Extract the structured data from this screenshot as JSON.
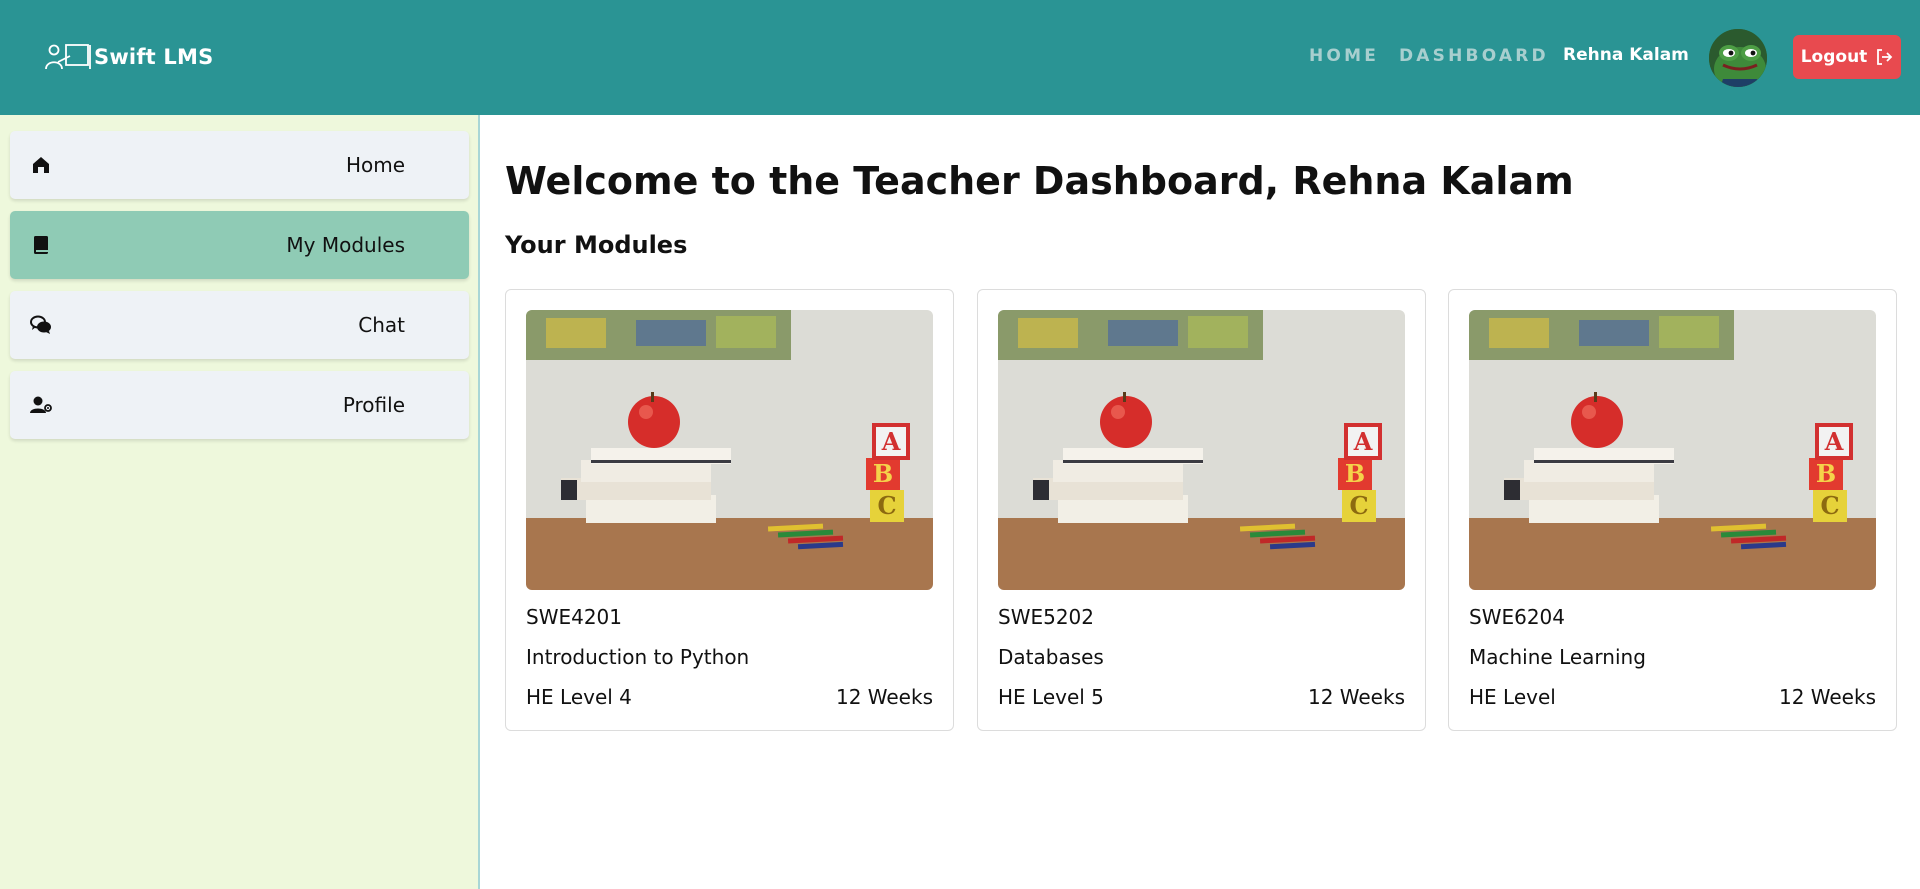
{
  "navbar": {
    "brand": "Swift LMS",
    "links": {
      "home": "HOME",
      "dashboard": "DASHBOARD"
    },
    "user_name": "Rehna Kalam",
    "logout_label": "Logout",
    "bg_color": "#2a9494",
    "logout_color": "#e84a4f"
  },
  "sidebar": {
    "items": [
      {
        "label": "Home",
        "icon": "home-icon"
      },
      {
        "label": "My Modules",
        "icon": "book-icon",
        "active": true
      },
      {
        "label": "Chat",
        "icon": "chat-icon"
      },
      {
        "label": "Profile",
        "icon": "user-gear-icon"
      }
    ],
    "active_color": "#8fcbb5",
    "bg_color": "#eef8dc"
  },
  "main": {
    "title": "Welcome to the Teacher Dashboard, Rehna Kalam",
    "section_title": "Your Modules",
    "modules": [
      {
        "code": "SWE4201",
        "name": "Introduction to Python",
        "level": "HE Level 4",
        "duration": "12 Weeks"
      },
      {
        "code": "SWE5202",
        "name": "Databases",
        "level": "HE Level 5",
        "duration": "12 Weeks"
      },
      {
        "code": "SWE6204",
        "name": "Machine Learning",
        "level": "HE Level",
        "duration": "12 Weeks"
      }
    ]
  }
}
